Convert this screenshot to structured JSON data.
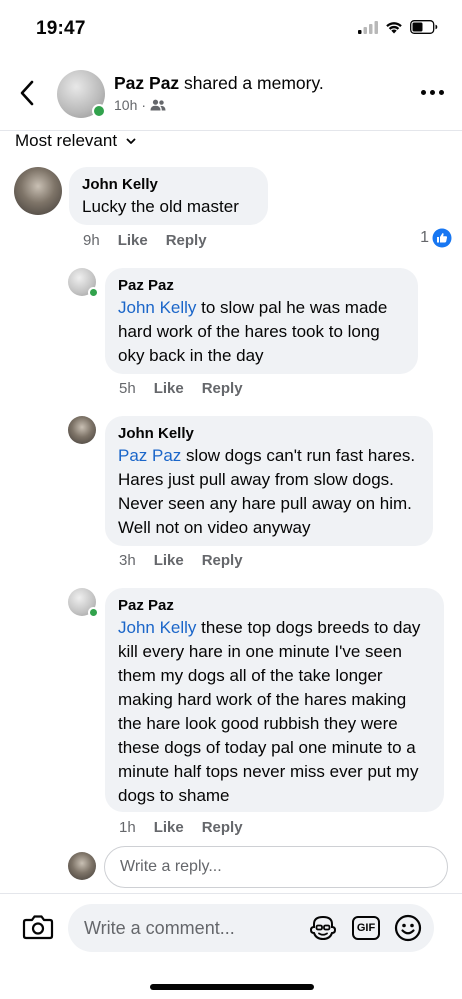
{
  "status_bar": {
    "time": "19:47"
  },
  "header": {
    "author": "Paz Paz",
    "action": " shared a memory.",
    "time": "10h",
    "separator": "·"
  },
  "sort": {
    "label": "Most relevant"
  },
  "comments": [
    {
      "name": "John Kelly",
      "mention": "",
      "text": "Lucky the old master",
      "time": "9h",
      "like": "Like",
      "reply": "Reply",
      "reaction_count": "1"
    },
    {
      "name": "Paz Paz",
      "mention": "John Kelly",
      "text": " to slow pal he was made hard work of the hares took to long oky back in the day",
      "time": "5h",
      "like": "Like",
      "reply": "Reply"
    },
    {
      "name": "John Kelly",
      "mention": "Paz Paz",
      "text": " slow dogs can't run fast hares. Hares just pull away from slow dogs. Never seen any hare pull away on him. Well not on video anyway",
      "time": "3h",
      "like": "Like",
      "reply": "Reply"
    },
    {
      "name": "Paz Paz",
      "mention": "John Kelly",
      "text": " these top dogs breeds to day kill every hare in one minute I've seen them my dogs all of the take longer making hard work of the hares making the hare look good rubbish they were these dogs of today pal one minute to a minute half tops never miss ever put my dogs to shame",
      "time": "1h",
      "like": "Like",
      "reply": "Reply"
    }
  ],
  "reply_input": {
    "placeholder": "Write a reply..."
  },
  "comment_input": {
    "placeholder": "Write a comment...",
    "gif_label": "GIF"
  },
  "colors": {
    "link": "#1b66c9",
    "online": "#31a24c",
    "like_blue": "#1877f2",
    "bubble": "#f0f2f5"
  }
}
